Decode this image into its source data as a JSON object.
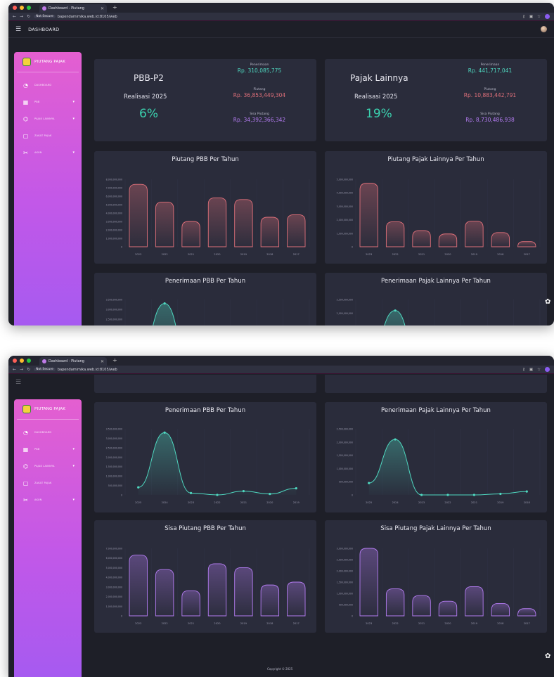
{
  "browser": {
    "tab_title": "Dashboard - Piutang",
    "not_secure": "Not Secure",
    "url": "bapendamimika.web.id:8105/web"
  },
  "app": {
    "title": "DASHBOARD",
    "footer": "Copyright © 2025"
  },
  "sidebar": {
    "brand": "PIUTANG PAJAK",
    "items": [
      {
        "label": "DASHBOARD",
        "icon": "chart-icon",
        "has_children": false
      },
      {
        "label": "PBB",
        "icon": "building-icon",
        "has_children": true
      },
      {
        "label": "PAJAK LAINNYA",
        "icon": "tax-icon",
        "has_children": true
      },
      {
        "label": "ZAKAT PAJAK",
        "icon": "doc-icon",
        "has_children": false
      },
      {
        "label": "AKUN",
        "icon": "user-icon",
        "has_children": true
      }
    ]
  },
  "summary": [
    {
      "name": "PBB-P2",
      "year_label": "Realisasi 2025",
      "percent": "6%",
      "penerimaan_label": "Penerimaan",
      "penerimaan": "Rp. 310,085,775",
      "piutang_label": "Piutang",
      "piutang": "Rp. 36,853,449,304",
      "sisa_label": "Sisa Piutang",
      "sisa": "Rp. 34,392,366,342"
    },
    {
      "name": "Pajak Lainnya",
      "year_label": "Realisasi 2025",
      "percent": "19%",
      "penerimaan_label": "Penerimaan",
      "penerimaan": "Rp. 441,717,041",
      "piutang_label": "Piutang",
      "piutang": "Rp. 10,883,442,791",
      "sisa_label": "Sisa Piutang",
      "sisa": "Rp. 8,730,486,938"
    }
  ],
  "colors": {
    "red": "#e0707a",
    "teal": "#4fd8c0",
    "purple": "#b47cf2",
    "accent_pct": "#3bd3b0"
  },
  "chart_data": [
    {
      "id": "piutang_pbb",
      "type": "bar",
      "title": "Piutang PBB Per Tahun",
      "categories": [
        "2023",
        "2022",
        "2021",
        "2020",
        "2019",
        "2018",
        "2017"
      ],
      "values": [
        7400000000,
        5300000000,
        3000000000,
        5800000000,
        5600000000,
        3500000000,
        3800000000
      ],
      "yticks": [
        0,
        1000000000,
        2000000000,
        3000000000,
        4000000000,
        5000000000,
        6000000000,
        7000000000,
        8000000000
      ],
      "ylim": [
        0,
        8000000000
      ]
    },
    {
      "id": "piutang_lain",
      "type": "bar",
      "title": "Piutang Pajak Lainnya Per Tahun",
      "categories": [
        "2023",
        "2022",
        "2021",
        "2020",
        "2019",
        "2018",
        "2017"
      ],
      "values": [
        4700000000,
        1850000000,
        1200000000,
        950000000,
        1900000000,
        1050000000,
        380000000
      ],
      "yticks": [
        0,
        1000000000,
        2000000000,
        3000000000,
        4000000000,
        5000000000
      ],
      "ylim": [
        0,
        5000000000
      ]
    },
    {
      "id": "penerimaan_pbb",
      "type": "area",
      "title": "Penerimaan PBB Per Tahun",
      "categories": [
        "2025",
        "2024",
        "2023",
        "2022",
        "2021",
        "2020",
        "2019"
      ],
      "values": [
        400000000,
        3300000000,
        100000000,
        0,
        200000000,
        50000000,
        350000000
      ],
      "yticks": [
        0,
        500000000,
        1000000000,
        1500000000,
        2000000000,
        2500000000,
        3000000000,
        3500000000
      ],
      "ylim": [
        0,
        3500000000
      ]
    },
    {
      "id": "penerimaan_lain",
      "type": "area",
      "title": "Penerimaan Pajak Lainnya Per Tahun",
      "categories": [
        "2025",
        "2024",
        "2023",
        "2022",
        "2021",
        "2019",
        "2018"
      ],
      "values": [
        450000000,
        2100000000,
        0,
        0,
        0,
        40000000,
        130000000
      ],
      "yticks": [
        0,
        500000000,
        1000000000,
        1500000000,
        2000000000,
        2500000000
      ],
      "ylim": [
        0,
        2500000000
      ]
    },
    {
      "id": "sisa_pbb",
      "type": "bar",
      "title": "Sisa Piutang PBB Per Tahun",
      "categories": [
        "2023",
        "2022",
        "2021",
        "2020",
        "2019",
        "2018",
        "2017"
      ],
      "values": [
        6300000000,
        4800000000,
        2600000000,
        5400000000,
        5000000000,
        3200000000,
        3500000000
      ],
      "yticks": [
        0,
        1000000000,
        2000000000,
        3000000000,
        4000000000,
        5000000000,
        6000000000,
        7000000000
      ],
      "ylim": [
        0,
        7000000000
      ]
    },
    {
      "id": "sisa_lain",
      "type": "bar",
      "title": "Sisa Piutang Pajak Lainnya Per Tahun",
      "categories": [
        "2023",
        "2022",
        "2021",
        "2020",
        "2019",
        "2018",
        "2017"
      ],
      "values": [
        3000000000,
        1200000000,
        900000000,
        650000000,
        1300000000,
        550000000,
        320000000
      ],
      "yticks": [
        0,
        500000000,
        1000000000,
        1500000000,
        2000000000,
        2500000000,
        3000000000
      ],
      "ylim": [
        0,
        3000000000
      ]
    }
  ]
}
